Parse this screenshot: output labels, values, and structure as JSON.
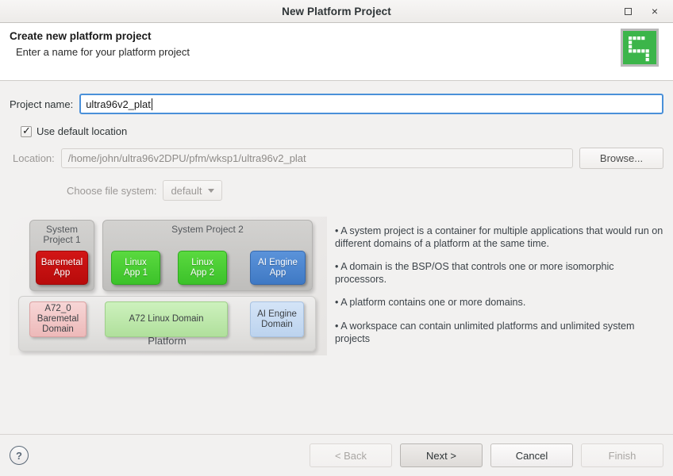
{
  "window": {
    "title": "New Platform Project",
    "controls": {
      "maximize": "maximize-icon",
      "close": "×"
    }
  },
  "header": {
    "title": "Create new platform project",
    "subtitle": "Enter a name for your platform project",
    "icon": "platform-project-icon",
    "icon_color": "#3cb54a"
  },
  "form": {
    "project_name_label": "Project name:",
    "project_name_value": "ultra96v2_plat",
    "use_default_location_label": "Use default location",
    "use_default_location_checked": true,
    "location_label": "Location:",
    "location_value": "/home/john/ultra96v2DPU/pfm/wksp1/ultra96v2_plat",
    "browse_label": "Browse...",
    "file_system_label": "Choose file system:",
    "file_system_value": "default"
  },
  "diagram": {
    "system_project_1_label": "System\nProject 1",
    "system_project_2_label": "System Project 2",
    "platform_label": "Platform",
    "apps": [
      {
        "label": "Baremetal\nApp",
        "color": "#c51111"
      },
      {
        "label": "Linux\nApp 1",
        "color": "#44cc33"
      },
      {
        "label": "Linux\nApp 2",
        "color": "#44cc33"
      },
      {
        "label": "AI Engine\nApp",
        "color": "#4a86d0"
      }
    ],
    "domains": [
      {
        "label": "A72_0\nBaremetal\nDomain",
        "color": "#f2c7c7"
      },
      {
        "label": "A72 Linux Domain",
        "color": "#bde9ad"
      },
      {
        "label": "AI Engine\nDomain",
        "color": "#c4d8f0"
      }
    ]
  },
  "bullets": [
    "• A system project is a container for multiple applications that would run on different domains of a platform at the same time.",
    "• A domain is the BSP/OS that controls one or more isomorphic processors.",
    "• A platform contains one or more domains.",
    "• A workspace can contain unlimited platforms and unlimited system projects"
  ],
  "footer": {
    "help": "?",
    "back_label": "< Back",
    "next_label": "Next >",
    "cancel_label": "Cancel",
    "finish_label": "Finish"
  }
}
